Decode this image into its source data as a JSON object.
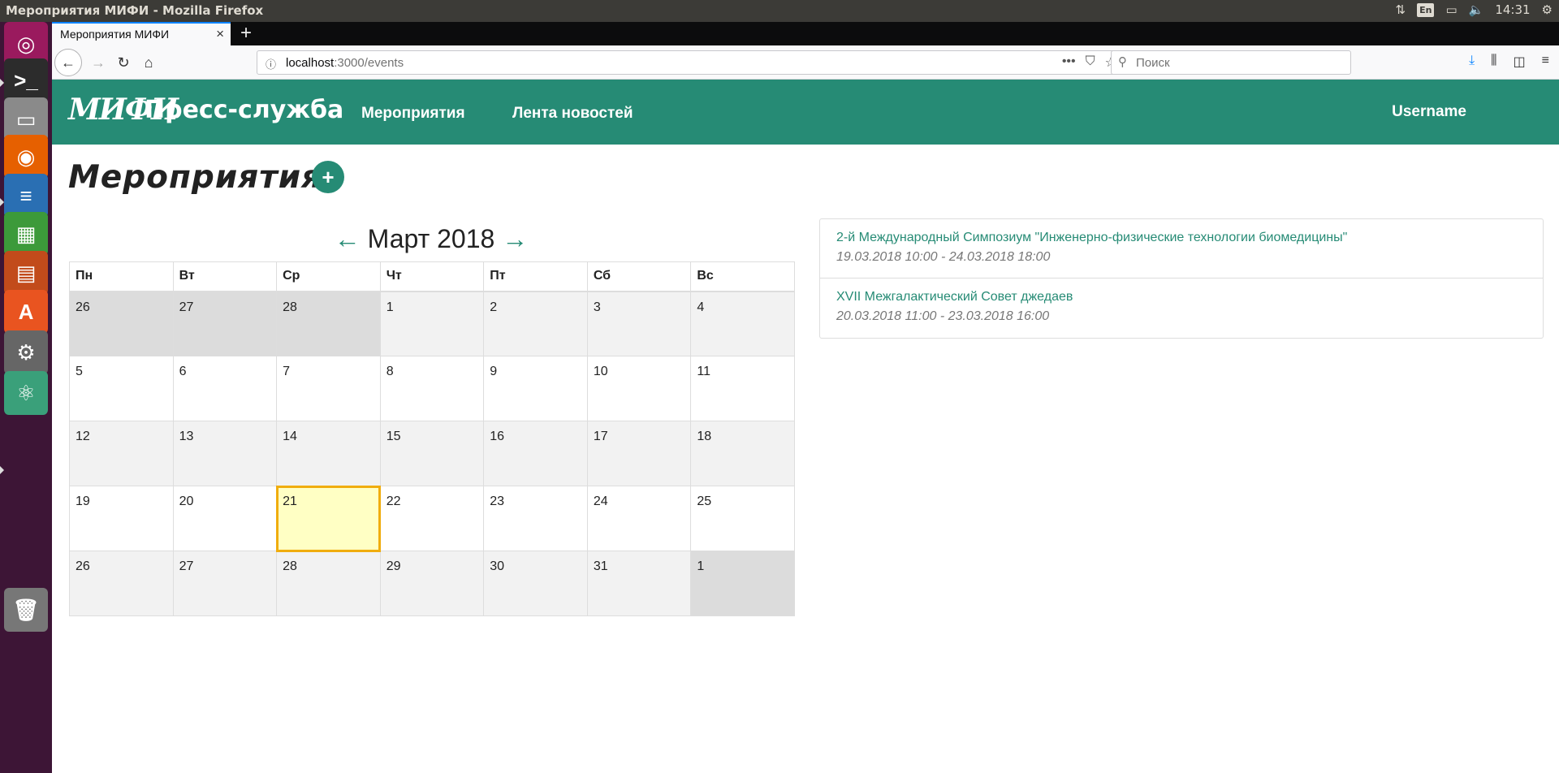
{
  "os": {
    "window_title": "Мероприятия МИФИ - Mozilla Firefox",
    "keyboard_layout": "En",
    "clock": "14:31"
  },
  "launcher": {
    "items": [
      {
        "name": "ubuntu-dash-icon",
        "glyph": "◎",
        "color": "#9a1a5e"
      },
      {
        "name": "terminal-icon",
        "glyph": ">_",
        "color": "#2c2c2c"
      },
      {
        "name": "file-manager-icon",
        "glyph": "▭",
        "color": "#8a8a8a"
      },
      {
        "name": "firefox-icon",
        "glyph": "◉",
        "color": "#e66000"
      },
      {
        "name": "writer-icon",
        "glyph": "≡",
        "color": "#2a6fb3"
      },
      {
        "name": "calc-icon",
        "glyph": "▦",
        "color": "#3c9a3a"
      },
      {
        "name": "impress-icon",
        "glyph": "▤",
        "color": "#c24b1b"
      },
      {
        "name": "software-center-icon",
        "glyph": "A",
        "color": "#e95420"
      },
      {
        "name": "system-settings-icon",
        "glyph": "⚙",
        "color": "#666"
      },
      {
        "name": "atom-icon",
        "glyph": "⚛",
        "color": "#3aa07a"
      },
      {
        "name": "trash-icon",
        "glyph": "🗑",
        "color": "#777"
      }
    ]
  },
  "browser": {
    "tab_title": "Мероприятия МИФИ",
    "url_host": "localhost",
    "url_path": ":3000/events",
    "search_placeholder": "Поиск"
  },
  "app": {
    "logo_text": "МИФИ",
    "brand": "Пресс-служба",
    "nav": [
      {
        "label": "Мероприятия"
      },
      {
        "label": "Лента новостей"
      }
    ],
    "username": "Username",
    "page_title": "Мероприятия",
    "add_label": "+"
  },
  "calendar": {
    "month_label": "Март 2018",
    "prev": "←",
    "next": "→",
    "weekdays": [
      "Пн",
      "Вт",
      "Ср",
      "Чт",
      "Пт",
      "Сб",
      "Вс"
    ],
    "weeks": [
      [
        {
          "d": "26",
          "other": true
        },
        {
          "d": "27",
          "other": true
        },
        {
          "d": "28",
          "other": true
        },
        {
          "d": "1"
        },
        {
          "d": "2"
        },
        {
          "d": "3"
        },
        {
          "d": "4"
        }
      ],
      [
        {
          "d": "5"
        },
        {
          "d": "6"
        },
        {
          "d": "7"
        },
        {
          "d": "8"
        },
        {
          "d": "9"
        },
        {
          "d": "10"
        },
        {
          "d": "11"
        }
      ],
      [
        {
          "d": "12"
        },
        {
          "d": "13"
        },
        {
          "d": "14"
        },
        {
          "d": "15"
        },
        {
          "d": "16"
        },
        {
          "d": "17"
        },
        {
          "d": "18"
        }
      ],
      [
        {
          "d": "19"
        },
        {
          "d": "20"
        },
        {
          "d": "21",
          "today": true
        },
        {
          "d": "22"
        },
        {
          "d": "23"
        },
        {
          "d": "24"
        },
        {
          "d": "25"
        }
      ],
      [
        {
          "d": "26"
        },
        {
          "d": "27"
        },
        {
          "d": "28"
        },
        {
          "d": "29"
        },
        {
          "d": "30"
        },
        {
          "d": "31"
        },
        {
          "d": "1",
          "other": true
        }
      ]
    ]
  },
  "events": [
    {
      "name": "2-й Международный Симпозиум \"Инженерно-физические технологии биомедицины\"",
      "dates": "19.03.2018 10:00 - 24.03.2018 18:00"
    },
    {
      "name": "XVII Межгалактический Совет джедаев",
      "dates": "20.03.2018 11:00 - 23.03.2018 16:00"
    }
  ],
  "colors": {
    "accent": "#268b75",
    "today_fill": "#ffffc4",
    "today_border": "#f0ad0e"
  }
}
